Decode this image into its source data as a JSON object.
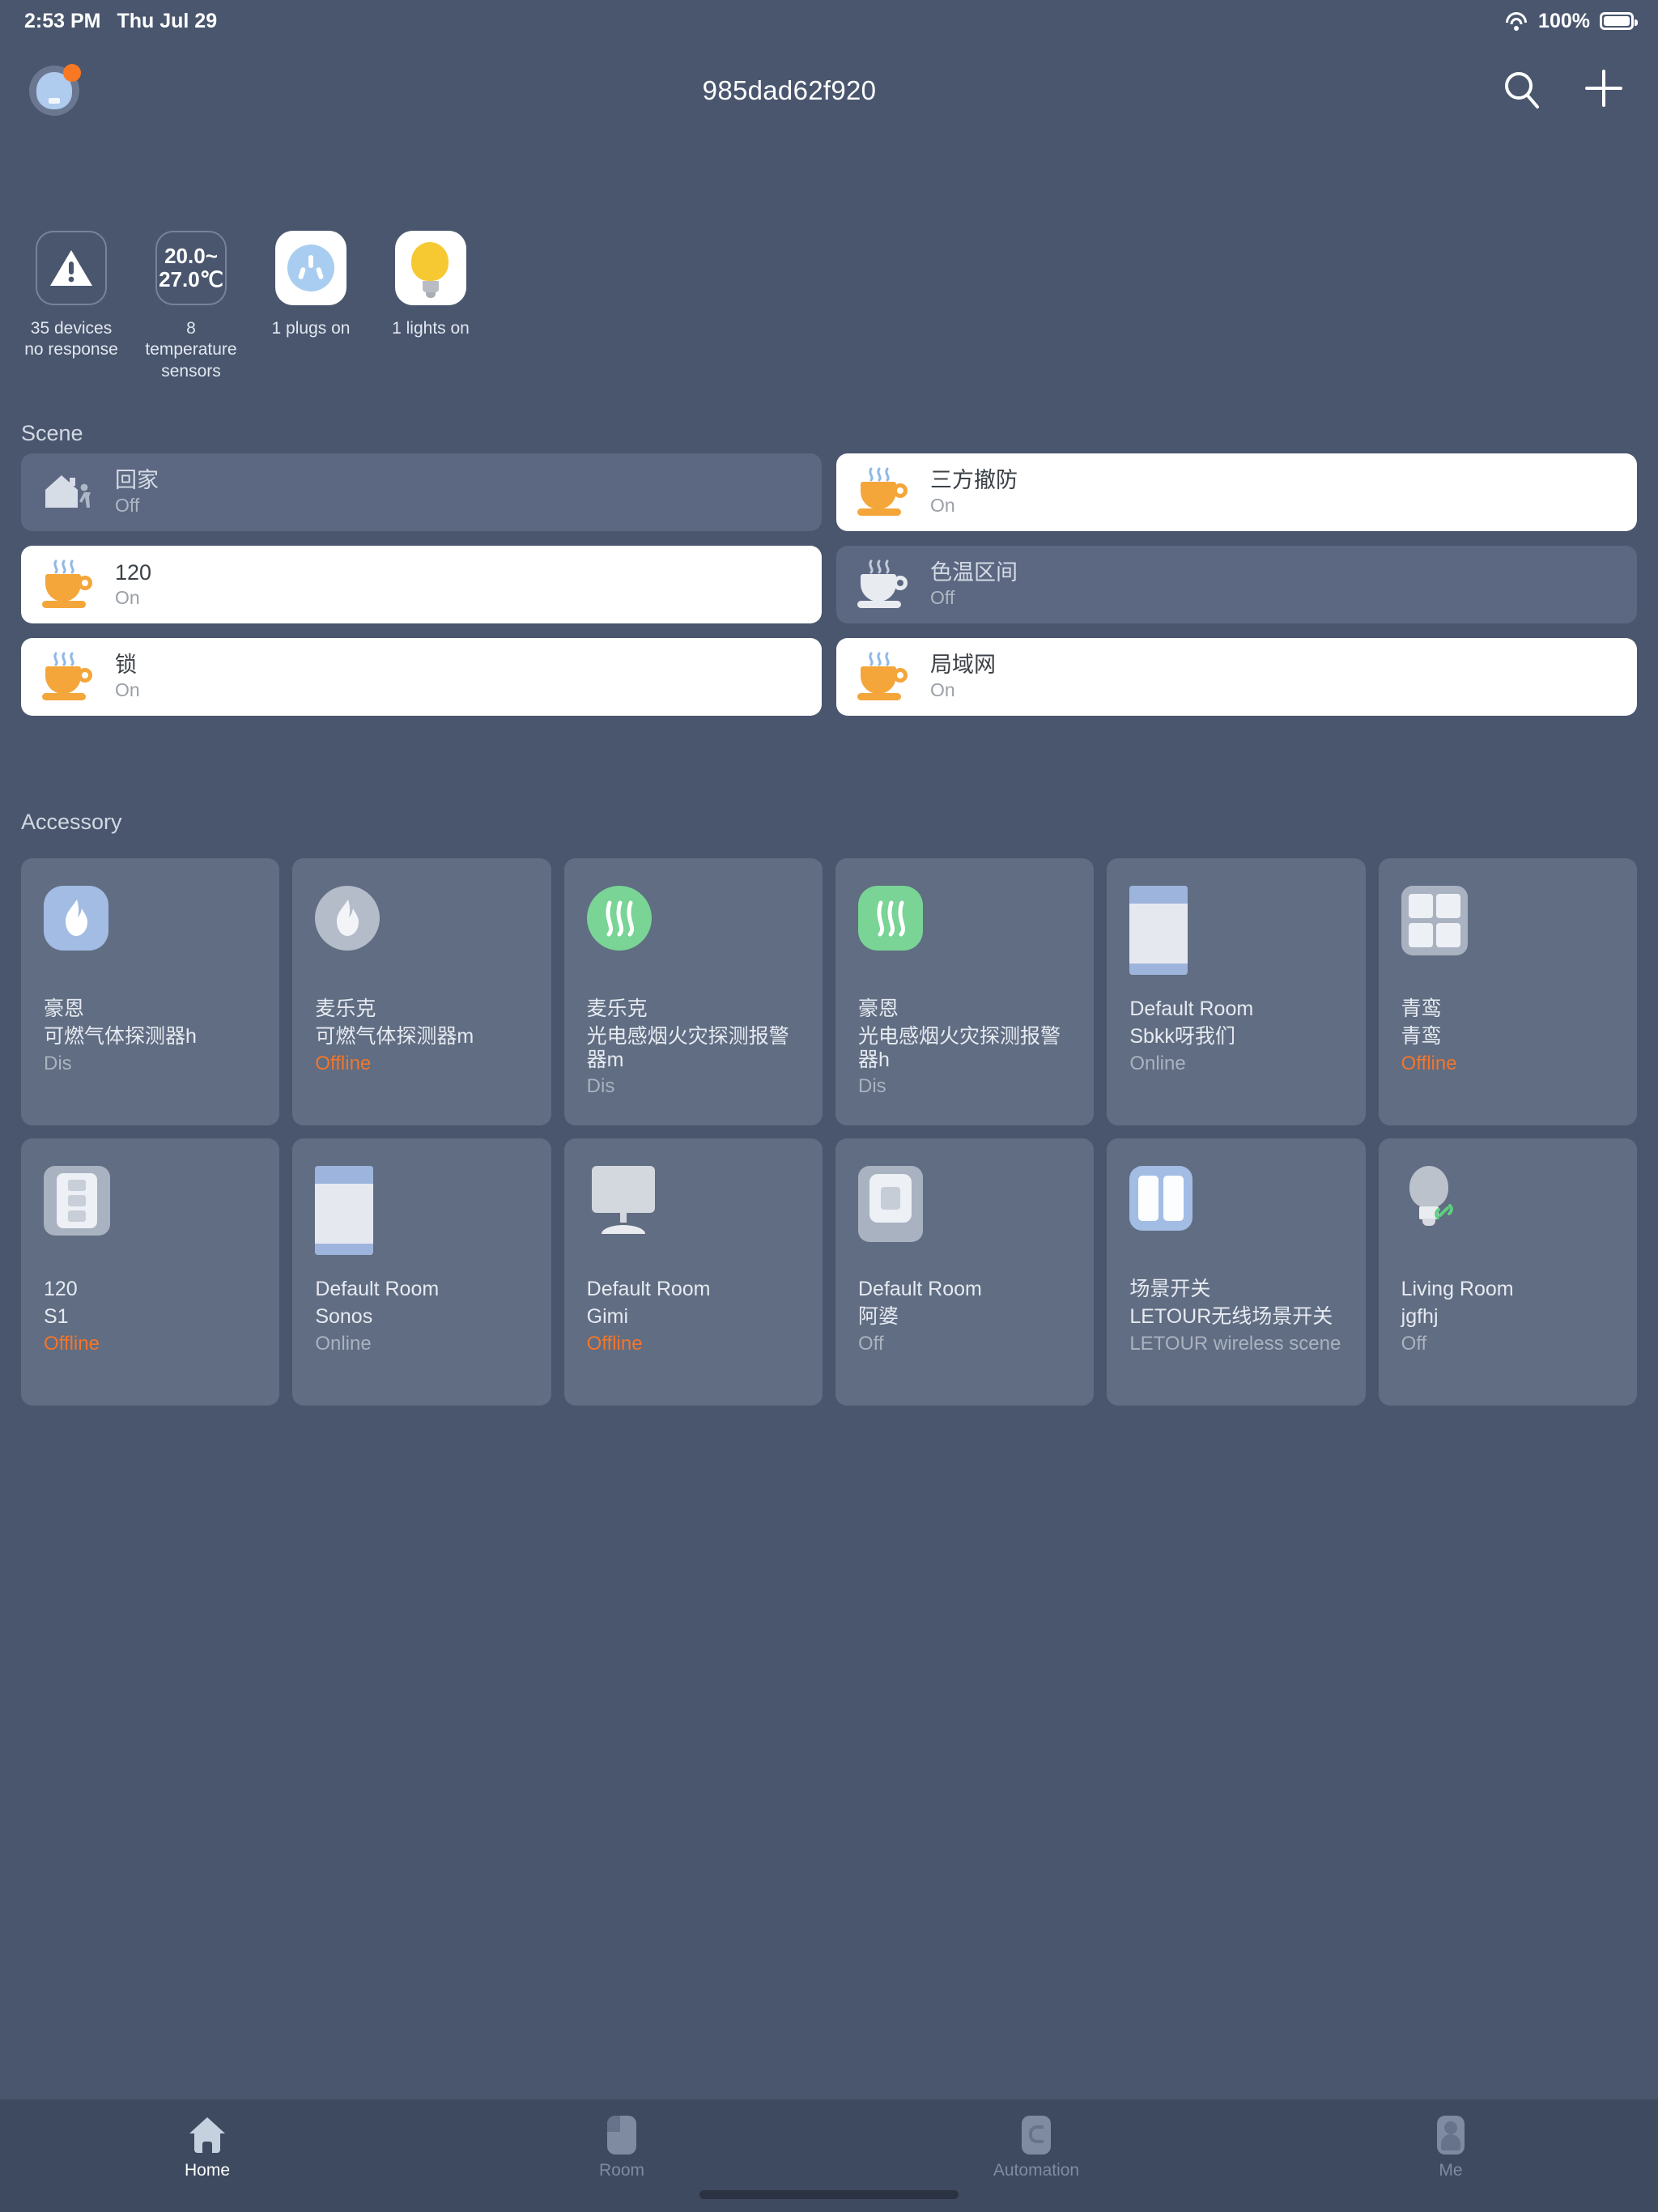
{
  "status_bar": {
    "time": "2:53 PM",
    "date": "Thu Jul 29",
    "battery_percent": "100%",
    "wifi_icon": "wifi-icon",
    "battery_icon": "battery-full-icon"
  },
  "nav": {
    "title": "985dad62f920",
    "avatar_icon": "user-avatar-icon",
    "search_icon": "search-icon",
    "add_icon": "plus-icon"
  },
  "summary": [
    {
      "icon": "warning-triangle-icon",
      "label": "35 devices no response",
      "style": "outline"
    },
    {
      "icon": "temperature-text",
      "value": "20.0~\n27.0℃",
      "label": "8 temperature sensors",
      "style": "outline"
    },
    {
      "icon": "power-plug-icon",
      "label": "1 plugs on",
      "style": "white"
    },
    {
      "icon": "light-bulb-icon",
      "label": "1 lights on",
      "style": "white"
    }
  ],
  "sections": {
    "scene_title": "Scene",
    "accessory_title": "Accessory"
  },
  "scenes": [
    {
      "name": "回家",
      "state": "Off",
      "on": false,
      "icon": "home-person-icon"
    },
    {
      "name": "三方撤防",
      "state": "On",
      "on": true,
      "icon": "coffee-cup-icon"
    },
    {
      "name": "120",
      "state": "On",
      "on": true,
      "icon": "coffee-cup-icon"
    },
    {
      "name": "色温区间",
      "state": "Off",
      "on": false,
      "icon": "coffee-cup-icon-grey"
    },
    {
      "name": "锁",
      "state": "On",
      "on": true,
      "icon": "coffee-cup-icon"
    },
    {
      "name": "局域网",
      "state": "On",
      "on": true,
      "icon": "coffee-cup-icon"
    }
  ],
  "accessories": [
    {
      "room": "豪恩",
      "device": "可燃气体探测器h",
      "state": "Dis",
      "offline": false,
      "icon": "gas-detector-icon-blue"
    },
    {
      "room": "麦乐克",
      "device": "可燃气体探测器m",
      "state": "Offline",
      "offline": true,
      "icon": "gas-detector-icon-grey"
    },
    {
      "room": "麦乐克",
      "device": "光电感烟火灾探测报警器m",
      "state": "Dis",
      "offline": false,
      "icon": "smoke-detector-icon-green"
    },
    {
      "room": "豪恩",
      "device": "光电感烟火灾探测报警器h",
      "state": "Dis",
      "offline": false,
      "icon": "smoke-detector-icon-green"
    },
    {
      "room": "Default Room",
      "device": "Sbkk呀我们",
      "state": "Online",
      "offline": false,
      "icon": "curtain-panel-icon"
    },
    {
      "room": "青鸾",
      "device": "青鸾",
      "state": "Offline",
      "offline": true,
      "icon": "four-gang-switch-icon"
    },
    {
      "room": "120",
      "device": "S1",
      "state": "Offline",
      "offline": true,
      "icon": "three-gang-switch-icon"
    },
    {
      "room": "Default Room",
      "device": "Sonos",
      "state": "Online",
      "offline": false,
      "icon": "curtain-panel-icon"
    },
    {
      "room": "Default Room",
      "device": "Gimi",
      "state": "Offline",
      "offline": true,
      "icon": "projector-tv-icon"
    },
    {
      "room": "Default Room",
      "device": "阿婆",
      "state": "Off",
      "offline": false,
      "icon": "square-panel-icon"
    },
    {
      "room": "场景开关",
      "device": "LETOUR无线场景开关",
      "state": "LETOUR wireless scene",
      "offline": false,
      "icon": "two-gang-switch-icon"
    },
    {
      "room": "Living Room",
      "device": "jgfhj",
      "state": "Off",
      "offline": false,
      "icon": "light-bulb-linked-icon"
    }
  ],
  "tabs": [
    {
      "label": "Home",
      "icon": "home-icon",
      "active": true
    },
    {
      "label": "Room",
      "icon": "room-icon",
      "active": false
    },
    {
      "label": "Automation",
      "icon": "automation-icon",
      "active": false
    },
    {
      "label": "Me",
      "icon": "me-icon",
      "active": false
    }
  ],
  "colors": {
    "background": "#49566E",
    "card": "#606D82",
    "scene_off": "#5C6882",
    "scene_on": "#FFFFFF",
    "offline": "#F2762B",
    "accent_orange": "#F97824",
    "tabbar": "#3E4A60"
  }
}
